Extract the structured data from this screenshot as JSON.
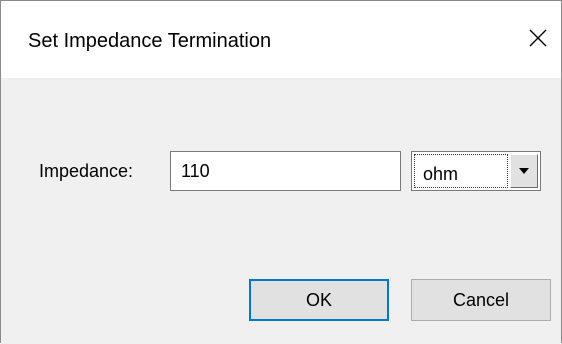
{
  "dialog": {
    "title": "Set Impedance Termination"
  },
  "form": {
    "impedance_label": "Impedance:",
    "impedance_value": "110",
    "unit_selected": "ohm"
  },
  "buttons": {
    "ok_label": "OK",
    "cancel_label": "Cancel"
  },
  "icons": {
    "close": "close-icon",
    "dropdown": "dropdown-arrow-icon"
  },
  "colors": {
    "focus_border": "#0078d7",
    "dialog_bg": "#f0f0f0",
    "titlebar_bg": "#ffffff"
  }
}
